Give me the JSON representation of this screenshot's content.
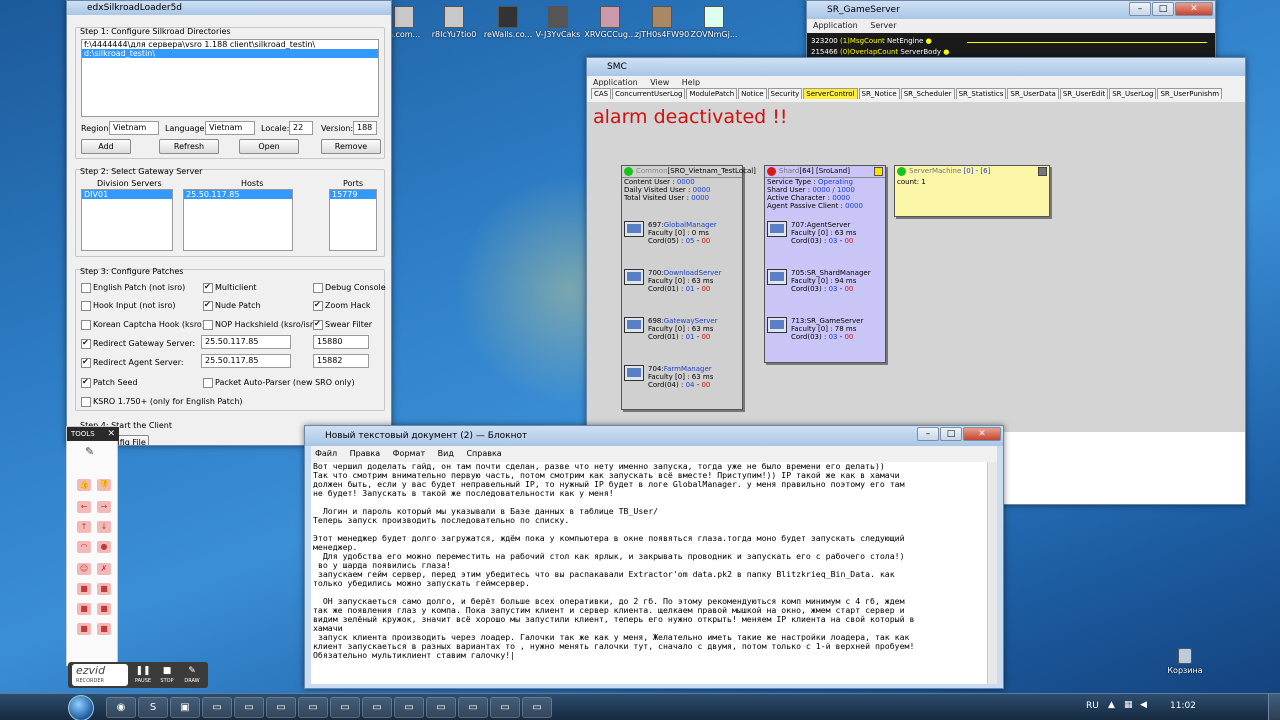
{
  "desktop": {
    "icons": [
      {
        "label": "n.com..."
      },
      {
        "label": "r8IcYu7tio0"
      },
      {
        "label": "reWalls.co..."
      },
      {
        "label": "V-J3YvCaks"
      },
      {
        "label": "XRVGCCug..."
      },
      {
        "label": "zjTH0s4FW90"
      },
      {
        "label": "ZOVNmGj..."
      }
    ],
    "recycle_bin": "Корзина"
  },
  "loader": {
    "title": "edxSilkroadLoader5d",
    "step1": {
      "title": "Step 1: Configure Silkroad Directories",
      "dirs": [
        "f:\\4444444\\для сервера\\vsro 1.188 client\\silkroad_testin\\",
        "d:\\silkroad_testin\\"
      ],
      "region_label": "Region:",
      "region": "Vietnam",
      "language_label": "Language:",
      "language": "Vietnam",
      "locale_label": "Locale:",
      "locale": "22",
      "version_label": "Version:",
      "version": "188",
      "add": "Add",
      "refresh": "Refresh",
      "open": "Open",
      "remove": "Remove"
    },
    "step2": {
      "title": "Step 2: Select Gateway Server",
      "col_division": "Division Servers",
      "col_hosts": "Hosts",
      "col_ports": "Ports",
      "division": "DIV01",
      "host": "25.50.117.85",
      "port": "15779"
    },
    "step3": {
      "title": "Step 3: Configure Patches",
      "english_patch": "English Patch (not isro)",
      "multiclient": "Multiclient",
      "debug_console": "Debug Console",
      "hook_input": "Hook Input (not isro)",
      "nude_patch": "Nude Patch",
      "zoom_hack": "Zoom Hack",
      "korean_captcha": "Korean Captcha Hook (ksro)",
      "nop_hackshield": "NOP Hackshield (ksro/isro)",
      "swear_filter": "Swear Filter",
      "redirect_gateway": "Redirect Gateway Server:",
      "gateway_ip": "25.50.117.85",
      "gateway_port": "15880",
      "redirect_agent": "Redirect Agent Server:",
      "agent_ip": "25.50.117.85",
      "agent_port": "15882",
      "patch_seed": "Patch Seed",
      "packet_parser": "Packet Auto-Parser (new SRO only)",
      "ksro": "KSRO 1.750+ (only for English Patch)"
    },
    "step4": {
      "title": "Step 4: Start the Client",
      "config_file": "Config File"
    }
  },
  "tools": {
    "label": "TOOLS",
    "close": "✕"
  },
  "ezvid": {
    "logo": "ezvid",
    "sub": "RECORDER",
    "pause": "PAUSE",
    "stop": "STOP",
    "draw": "DRAW"
  },
  "gameserver": {
    "title": "SR_GameServer",
    "menu": [
      "Application",
      "Server"
    ],
    "rows": [
      {
        "num": "323200",
        "label": "(1)MsgCount",
        "tag": "NetEngine"
      },
      {
        "num": "215466",
        "label": "(0)OverlapCount",
        "tag": "ServerBody"
      }
    ]
  },
  "smc": {
    "title": "SMC",
    "menu": [
      "Application",
      "View",
      "Help"
    ],
    "tabs": [
      "CAS",
      "ConcurrentUserLog",
      "ModulePatch",
      "Notice",
      "Security",
      "ServerControl",
      "SR_Notice",
      "SR_Scheduler",
      "SR_Statistics",
      "SR_UserData",
      "SR_UserEdit",
      "SR_UserLog",
      "SR_UserPunishm"
    ],
    "alarm": "alarm deactivated !!",
    "common": {
      "header_prefix": "Common",
      "header_name": "[SRO_Vietnam_TestLocal]",
      "l1": "Content User :",
      "v1": "0000",
      "l2": "Daily Visited User :",
      "v2": "0000",
      "l3": "Total Visited User :",
      "v3": "0000",
      "servers": [
        {
          "id": "697:",
          "name": "GlobalManager",
          "faculty": "Faculty [0] : 0 ms",
          "cord": "Cord(05) :",
          "c1": "05",
          "c2": "00"
        },
        {
          "id": "700:",
          "name": "DownloadServer",
          "faculty": "Faculty [0] : 63 ms",
          "cord": "Cord(01) :",
          "c1": "01",
          "c2": "00"
        },
        {
          "id": "698:",
          "name": "GatewayServer",
          "faculty": "Faculty [0] : 63 ms",
          "cord": "Cord(01) :",
          "c1": "01",
          "c2": "00"
        },
        {
          "id": "704:",
          "name": "FarmManager",
          "faculty": "Faculty [0] : 63 ms",
          "cord": "Cord(04) :",
          "c1": "04",
          "c2": "00"
        }
      ]
    },
    "shard": {
      "header_prefix": "Shard",
      "header_name": "[64] [SroLand]",
      "l1": "Service Type :",
      "v1": "Operating",
      "l2": "Shard User :",
      "v2": "0000 / 1000",
      "l3": "Active Character :",
      "v3": "0000",
      "l4": "Agent Passive Client :",
      "v4": "0000",
      "servers": [
        {
          "id": "707:",
          "name": "AgentServer",
          "faculty": "Faculty [0] : 63 ms",
          "cord": "Cord(03) :",
          "c1": "03",
          "c2": "00"
        },
        {
          "id": "705:",
          "name": "SR_ShardManager",
          "faculty": "Faculty [0] : 94 ms",
          "cord": "Cord(03) :",
          "c1": "03",
          "c2": "00"
        },
        {
          "id": "713:",
          "name": "SR_GameServer",
          "faculty": "Faculty [0] : 78 ms",
          "cord": "Cord(03) :",
          "c1": "03",
          "c2": "00"
        }
      ]
    },
    "machine": {
      "header_prefix": "ServerMachine",
      "header_name": "[0] - [6]",
      "count": "count: 1"
    }
  },
  "notepad": {
    "title": "Новый текстовый документ (2) — Блокнот",
    "menu": [
      "Файл",
      "Правка",
      "Формат",
      "Вид",
      "Справка"
    ],
    "text": "Вот чершил доделать гайд, он там почти сделан, разве что нету именно запуска, тогда уже не было времени его делать))\nТак что смотрим внимательно первую часть, потом смотрим как запускать всё вместе! Приступим!)) IP такой же как в хамачи\nдолжен быть, если у вас будет неправельный IP, то нужный IP будет в логе GlobalManager. у меня правильно поэтому его там\nне будет! Запускать в такой же последовательности как у меня!\n\n  Логин и пароль который мы указывали в Базе данных в таблице TB_User/\nТеперь запуск производить последовательно по списку.\n\nЭтот менеджер будет долго загружатся, ждём пока у компьютера в окне появяться глаза.тогда моно будет запускать следующий\nменеджер.\n  Для удобства его можно переместить на рабочий стол как ярлык, и закрывать проводник и запускать его с рабочего стола!)\n во у шарда появились глаза!\n запускаем гейм сервер, перед этим убедитесь что вы распакавали Extractor'om data.pk2 в папку Blitzkrieq_Bin_Data. как\nтолько убедились можно запускать геймсервер.\n\n  ОН запускаеться само долго, и берёт больше всех оперативки, до 2 гб. По этому рекомендуються комп минимум с 4 гб, ждем\nтак же появления глаз у компа. Пока запустим клиент и сервер клиента. щелкаем правой мышкой на окно, жмем старт сервер и\nвидим зелёный кружок, значит всё хорошо мы запустили клиент, теперь его нужно открыть! меняем IP клиента на свой который в\nхамачи\n запуск клиента производить через лоадер. Галочки так же как у меня, Желательно иметь такие же настройки лоадера, так как\nклиент запускаеться в разных вариантах то , нужно менять галочки тут, сначало с двумя, потом только с 1-й верхней пробуем!\nОбязательно мультиклиент ставим галочку!|"
  },
  "taskbar": {
    "lang": "RU",
    "time": "11:02"
  },
  "colors": {
    "alarm": "#d01010",
    "shard_bg": "#c9c6f7",
    "machine_bg": "#fbf6a8",
    "common_bg": "#d0d0d0",
    "active_tab": "#ffef3a"
  }
}
